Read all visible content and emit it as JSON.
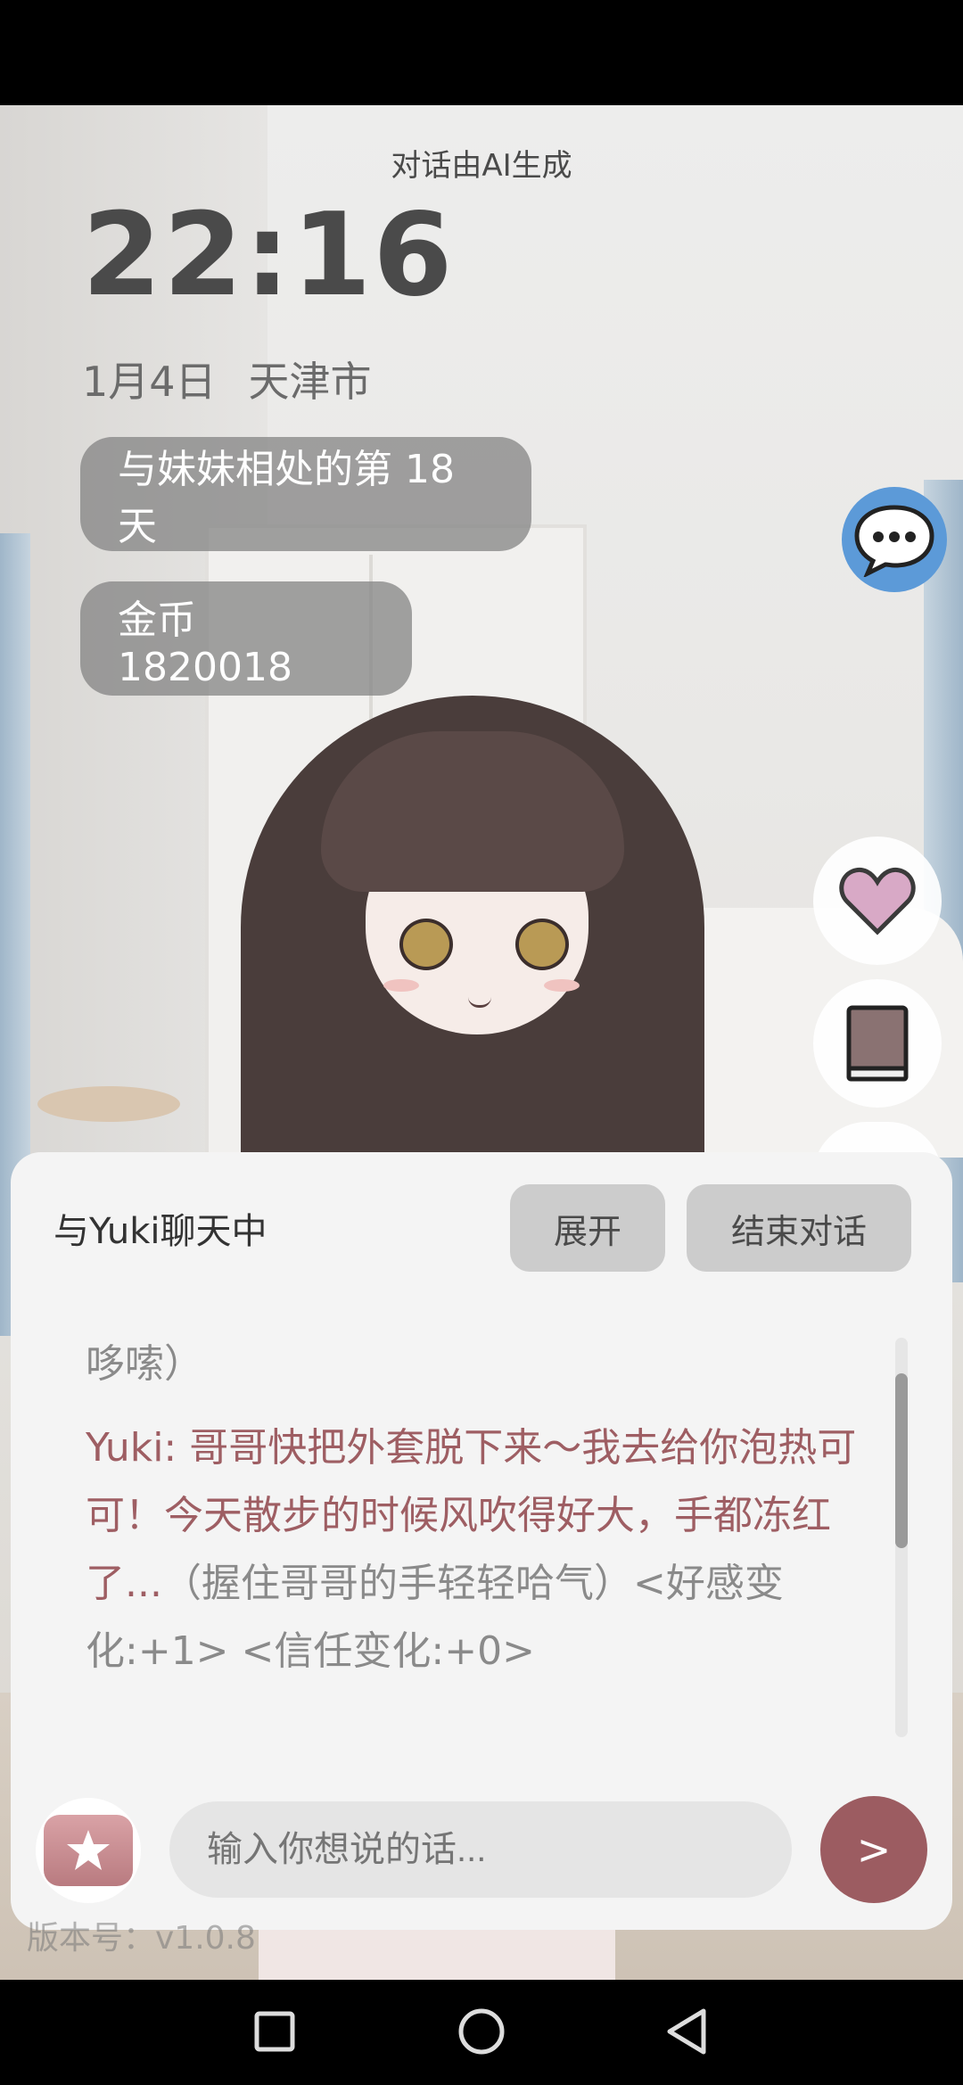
{
  "ai_notice": "对话由AI生成",
  "clock": "22:16",
  "date": "1月4日",
  "location": "天津市",
  "days_together": "与妹妹相处的第 18 天",
  "coins": "金币 1820018",
  "chat": {
    "title": "与Yuki聊天中",
    "expand_label": "展开",
    "end_label": "结束对话",
    "previous_fragment": "哆嗦）",
    "speaker": "Yuki: ",
    "speech": "哥哥快把外套脱下来～我去给你泡热可可！今天散步的时候风吹得好大，手都冻红了...",
    "action": "（握住哥哥的手轻轻哈气）",
    "stats": "<好感变化:+1> <信任变化:+0>",
    "input_placeholder": "输入你想说的话...",
    "send_label": ">"
  },
  "version": "版本号：v1.0.8",
  "colors": {
    "accent": "#9c5c61",
    "chat_icon_bg": "#5c9ad8",
    "heart": "#d8a9c6"
  },
  "icons": {
    "chat": "speech-bubble-icon",
    "heart": "heart-icon",
    "book": "book-icon",
    "gift": "gift-star-icon",
    "nav_recent": "square-icon",
    "nav_home": "circle-icon",
    "nav_back": "triangle-back-icon"
  }
}
